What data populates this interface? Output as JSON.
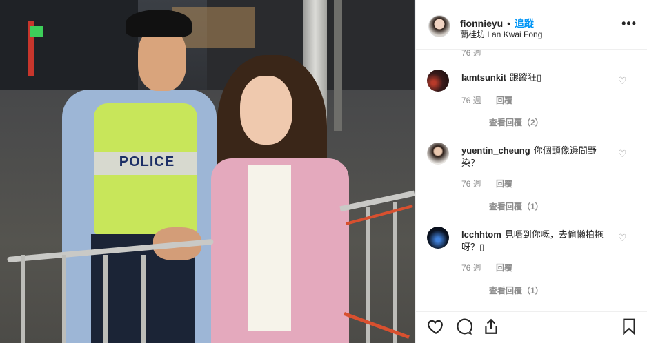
{
  "post": {
    "username": "fionnieyu",
    "separator": "•",
    "follow_label": "追蹤",
    "location": "蘭桂坊 Lan Kwai Fong",
    "more_label": "•••",
    "photo_text": "POLICE"
  },
  "comments": {
    "top_meta": "76 週",
    "items": [
      {
        "username": "lamtsunkit",
        "text": "跟蹤狂▯",
        "time": "76 週",
        "reply_label": "回覆",
        "view_replies": "查看回覆（2）"
      },
      {
        "username": "yuentin_cheung",
        "text": "你個頭像邊間野染？",
        "time": "76 週",
        "reply_label": "回覆",
        "view_replies": "查看回覆（1）"
      },
      {
        "username": "lcchhtom",
        "text": "見唔到你嘅，去偷懶拍拖呀？▯",
        "time": "76 週",
        "reply_label": "回覆",
        "view_replies": "查看回覆（1）"
      }
    ]
  },
  "icons": {
    "like": "heart-icon",
    "comment": "comment-icon",
    "share": "share-icon",
    "save": "bookmark-icon",
    "comment_like": "small-heart-icon"
  },
  "colors": {
    "link_blue": "#0095f6",
    "text": "#262626",
    "muted": "#8e8e8e",
    "border": "#efefef"
  }
}
